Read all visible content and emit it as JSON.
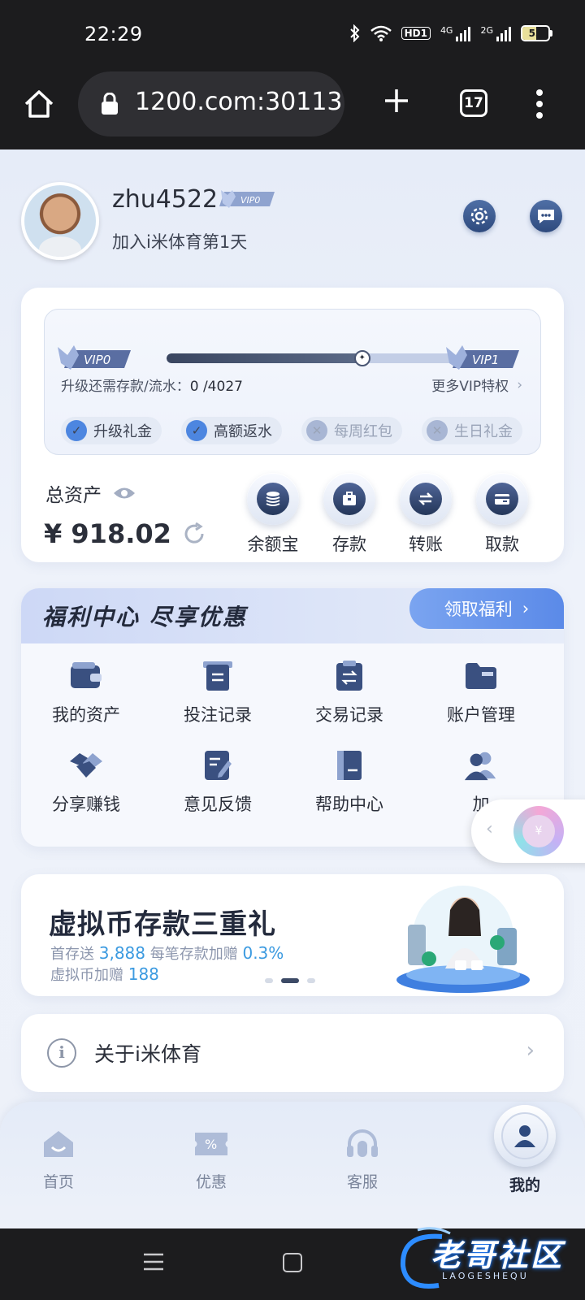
{
  "status": {
    "time": "22:29",
    "hd": "HD1",
    "sig1": "4G",
    "sig2": "2G",
    "battery": "53",
    "battery_level": 0.53
  },
  "browser": {
    "url": "1200.com:30113",
    "tab_count": "17"
  },
  "profile": {
    "username": "zhu4522",
    "vip_badge": "VIP0",
    "joined": "加入i米体育第1天"
  },
  "vip": {
    "current": "VIP0",
    "next": "VIP1",
    "progress": 0.68,
    "requirement_label": "升级还需存款/流水：",
    "requirement_value": "0 /4027",
    "more_label": "更多VIP特权",
    "perks": [
      {
        "label": "升级礼金",
        "enabled": true
      },
      {
        "label": "高额返水",
        "enabled": true
      },
      {
        "label": "每周红包",
        "enabled": false
      },
      {
        "label": "生日礼金",
        "enabled": false
      }
    ]
  },
  "assets": {
    "label": "总资产",
    "value": "¥ 918.02"
  },
  "actions": [
    {
      "label": "余额宝",
      "icon": "coins-icon"
    },
    {
      "label": "存款",
      "icon": "deposit-icon"
    },
    {
      "label": "转账",
      "icon": "transfer-icon"
    },
    {
      "label": "取款",
      "icon": "withdraw-card-icon"
    }
  ],
  "welfare": {
    "title": "福利中心 尽享优惠",
    "claim_label": "领取福利",
    "items": [
      {
        "label": "我的资产",
        "icon": "wallet-icon"
      },
      {
        "label": "投注记录",
        "icon": "bet-record-icon"
      },
      {
        "label": "交易记录",
        "icon": "transaction-record-icon"
      },
      {
        "label": "账户管理",
        "icon": "account-folder-icon"
      },
      {
        "label": "分享赚钱",
        "icon": "handshake-icon"
      },
      {
        "label": "意见反馈",
        "icon": "feedback-icon"
      },
      {
        "label": "帮助中心",
        "icon": "help-book-icon"
      },
      {
        "label": "加",
        "icon": "users-icon"
      }
    ]
  },
  "float_widget": {
    "symbol": "¥"
  },
  "banner": {
    "title": "虚拟币存款三重礼",
    "line1_prefix": "首存送",
    "line1_value": "3,888",
    "line1_mid": "每笔存款加赠",
    "line1_value2": "0.3%",
    "line2_prefix": "虚拟币加赠",
    "line2_value": "188"
  },
  "about": {
    "label": "关于i米体育"
  },
  "tabs": [
    {
      "label": "首页",
      "icon": "home-icon"
    },
    {
      "label": "优惠",
      "icon": "coupon-icon"
    },
    {
      "label": "客服",
      "icon": "headset-icon"
    },
    {
      "label": "我的",
      "icon": "user-icon"
    }
  ],
  "watermark": {
    "text": "老哥社区",
    "sub": "LAOGESHEQU"
  },
  "colors": {
    "accent": "#4d86e0",
    "claim": "#5b8ae8",
    "dark_icon": "#2e4a7e",
    "highlight": "#3b9ae0"
  }
}
